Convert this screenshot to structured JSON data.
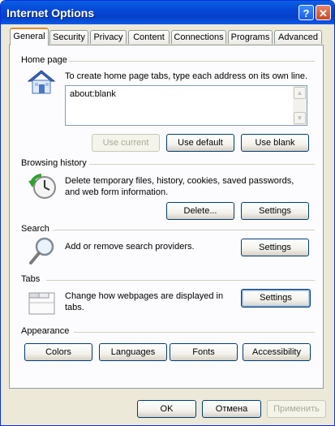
{
  "window": {
    "title": "Internet Options",
    "help_glyph": "?",
    "close_glyph": "✕"
  },
  "tabs": [
    {
      "label": "General",
      "active": true
    },
    {
      "label": "Security"
    },
    {
      "label": "Privacy"
    },
    {
      "label": "Content"
    },
    {
      "label": "Connections"
    },
    {
      "label": "Programs"
    },
    {
      "label": "Advanced"
    }
  ],
  "home_page": {
    "section_label": "Home page",
    "description": "To create home page tabs, type each address on its own line.",
    "address_value": "about:blank",
    "buttons": {
      "use_current": "Use current",
      "use_default": "Use default",
      "use_blank": "Use blank"
    },
    "icon": "house-icon"
  },
  "browsing_history": {
    "section_label": "Browsing history",
    "description": "Delete temporary files, history, cookies, saved passwords, and web form information.",
    "buttons": {
      "delete": "Delete...",
      "settings": "Settings"
    },
    "icon": "history-clock-icon"
  },
  "search": {
    "section_label": "Search",
    "description": "Add or remove search providers.",
    "buttons": {
      "settings": "Settings"
    },
    "icon": "magnifier-icon"
  },
  "tabs_section": {
    "section_label": "Tabs",
    "description": "Change how webpages are displayed in tabs.",
    "buttons": {
      "settings": "Settings"
    },
    "icon": "tabbed-window-icon"
  },
  "appearance": {
    "section_label": "Appearance",
    "buttons": {
      "colors": "Colors",
      "languages": "Languages",
      "fonts": "Fonts",
      "accessibility": "Accessibility"
    }
  },
  "footer": {
    "ok": "OK",
    "cancel": "Отмена",
    "apply": "Применить"
  },
  "colors": {
    "title_bar": "#0548d8",
    "tab_highlight": "#e68b2c",
    "dialog_bg": "#ece9d8"
  }
}
